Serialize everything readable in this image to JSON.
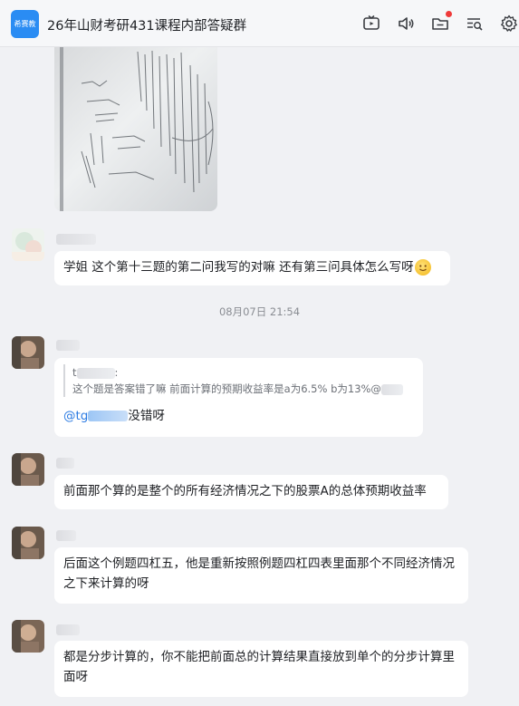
{
  "header": {
    "group_avatar_text": "希赛教育",
    "title": "26年山财考研431课程内部答疑群",
    "icons": [
      "tv-icon",
      "speaker-icon",
      "folder-icon",
      "search-list-icon",
      "gear-icon"
    ]
  },
  "messages": {
    "m1_text": "学姐 这个第十三题的第二问我写的对嘛 还有第三问具体怎么写呀",
    "timestamp": "08月07日 21:54",
    "m2_quote_tail": ":",
    "m2_quote_text": "这个题是答案错了嘛 前面计算的预期收益率是a为6.5% b为13%@",
    "m2_mention_prefix": "@tg",
    "m2_reply": "没错呀",
    "m3_text": "前面那个算的是整个的所有经济情况之下的股票A的总体预期收益率",
    "m4_text": "后面这个例题四杠五，他是重新按照例题四杠四表里面那个不同经济情况之下来计算的呀",
    "m5_text": "都是分步计算的，你不能把前面总的计算结果直接放到单个的分步计算里面呀"
  },
  "colors": {
    "background": "#f0f1f4",
    "bubble": "#ffffff",
    "mention": "#2a7ae2",
    "notify_dot": "#ef3a3a"
  }
}
